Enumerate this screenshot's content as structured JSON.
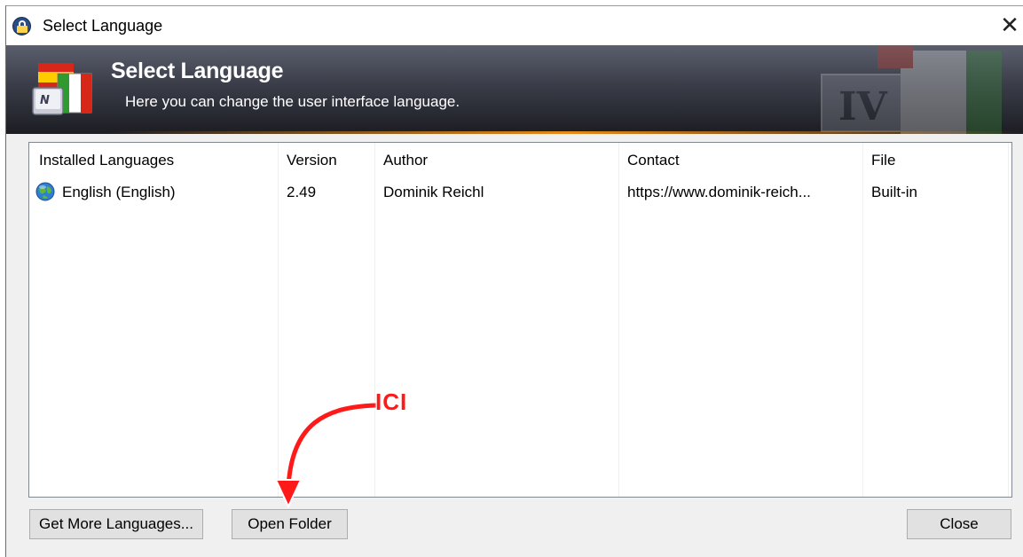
{
  "window": {
    "title": "Select Language",
    "close_glyph": "✕"
  },
  "banner": {
    "title": "Select Language",
    "subtitle": "Here you can change the user interface language.",
    "accent_color": "#e98a17"
  },
  "list": {
    "columns": [
      "Installed Languages",
      "Version",
      "Author",
      "Contact",
      "File"
    ],
    "rows": [
      {
        "icon": "globe-icon",
        "language": "English (English)",
        "version": "2.49",
        "author": "Dominik Reichl",
        "contact": "https://www.dominik-reich...",
        "file": "Built-in"
      }
    ]
  },
  "buttons": {
    "get_more": "Get More Languages...",
    "open_folder": "Open Folder",
    "close": "Close"
  },
  "annotation": {
    "label": "ICI",
    "color": "#ff1a1a"
  }
}
